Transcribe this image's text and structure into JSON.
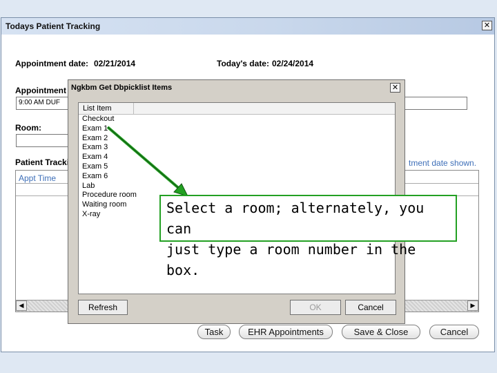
{
  "window": {
    "title": "Todays Patient Tracking",
    "close_glyph": "✕"
  },
  "appointment_date": {
    "label": "Appointment date:",
    "value": "02/21/2014"
  },
  "todays_date": {
    "label": "Today's date:",
    "value": "02/24/2014"
  },
  "appointment_label": "Appointment",
  "appointment_value": "9:00 AM DUF",
  "room_label": "Room:",
  "patient_tracking_label": "Patient Tracki",
  "info_text": "tment date shown.",
  "grid": {
    "column_appt_time": "Appt Time",
    "left_arrow": "◀",
    "right_arrow": "▶"
  },
  "buttons": {
    "task": "Task",
    "ehr": "EHR Appointments",
    "save_close": "Save & Close",
    "cancel": "Cancel"
  },
  "dialog": {
    "title": "Ngkbm Get Dbpicklist Items",
    "close_glyph": "✕",
    "column": "List Item",
    "items": [
      "Checkout",
      "Exam 1",
      "Exam 2",
      "Exam 3",
      "Exam 4",
      "Exam 5",
      "Exam 6",
      "Lab",
      "Procedure room",
      "Waiting room",
      "X-ray"
    ],
    "refresh": "Refresh",
    "ok": "OK",
    "cancel": "Cancel"
  },
  "callout": {
    "line1": "Select a room; alternately, you can",
    "line2": "just type a room number in the box.",
    "color": "#22a022"
  }
}
